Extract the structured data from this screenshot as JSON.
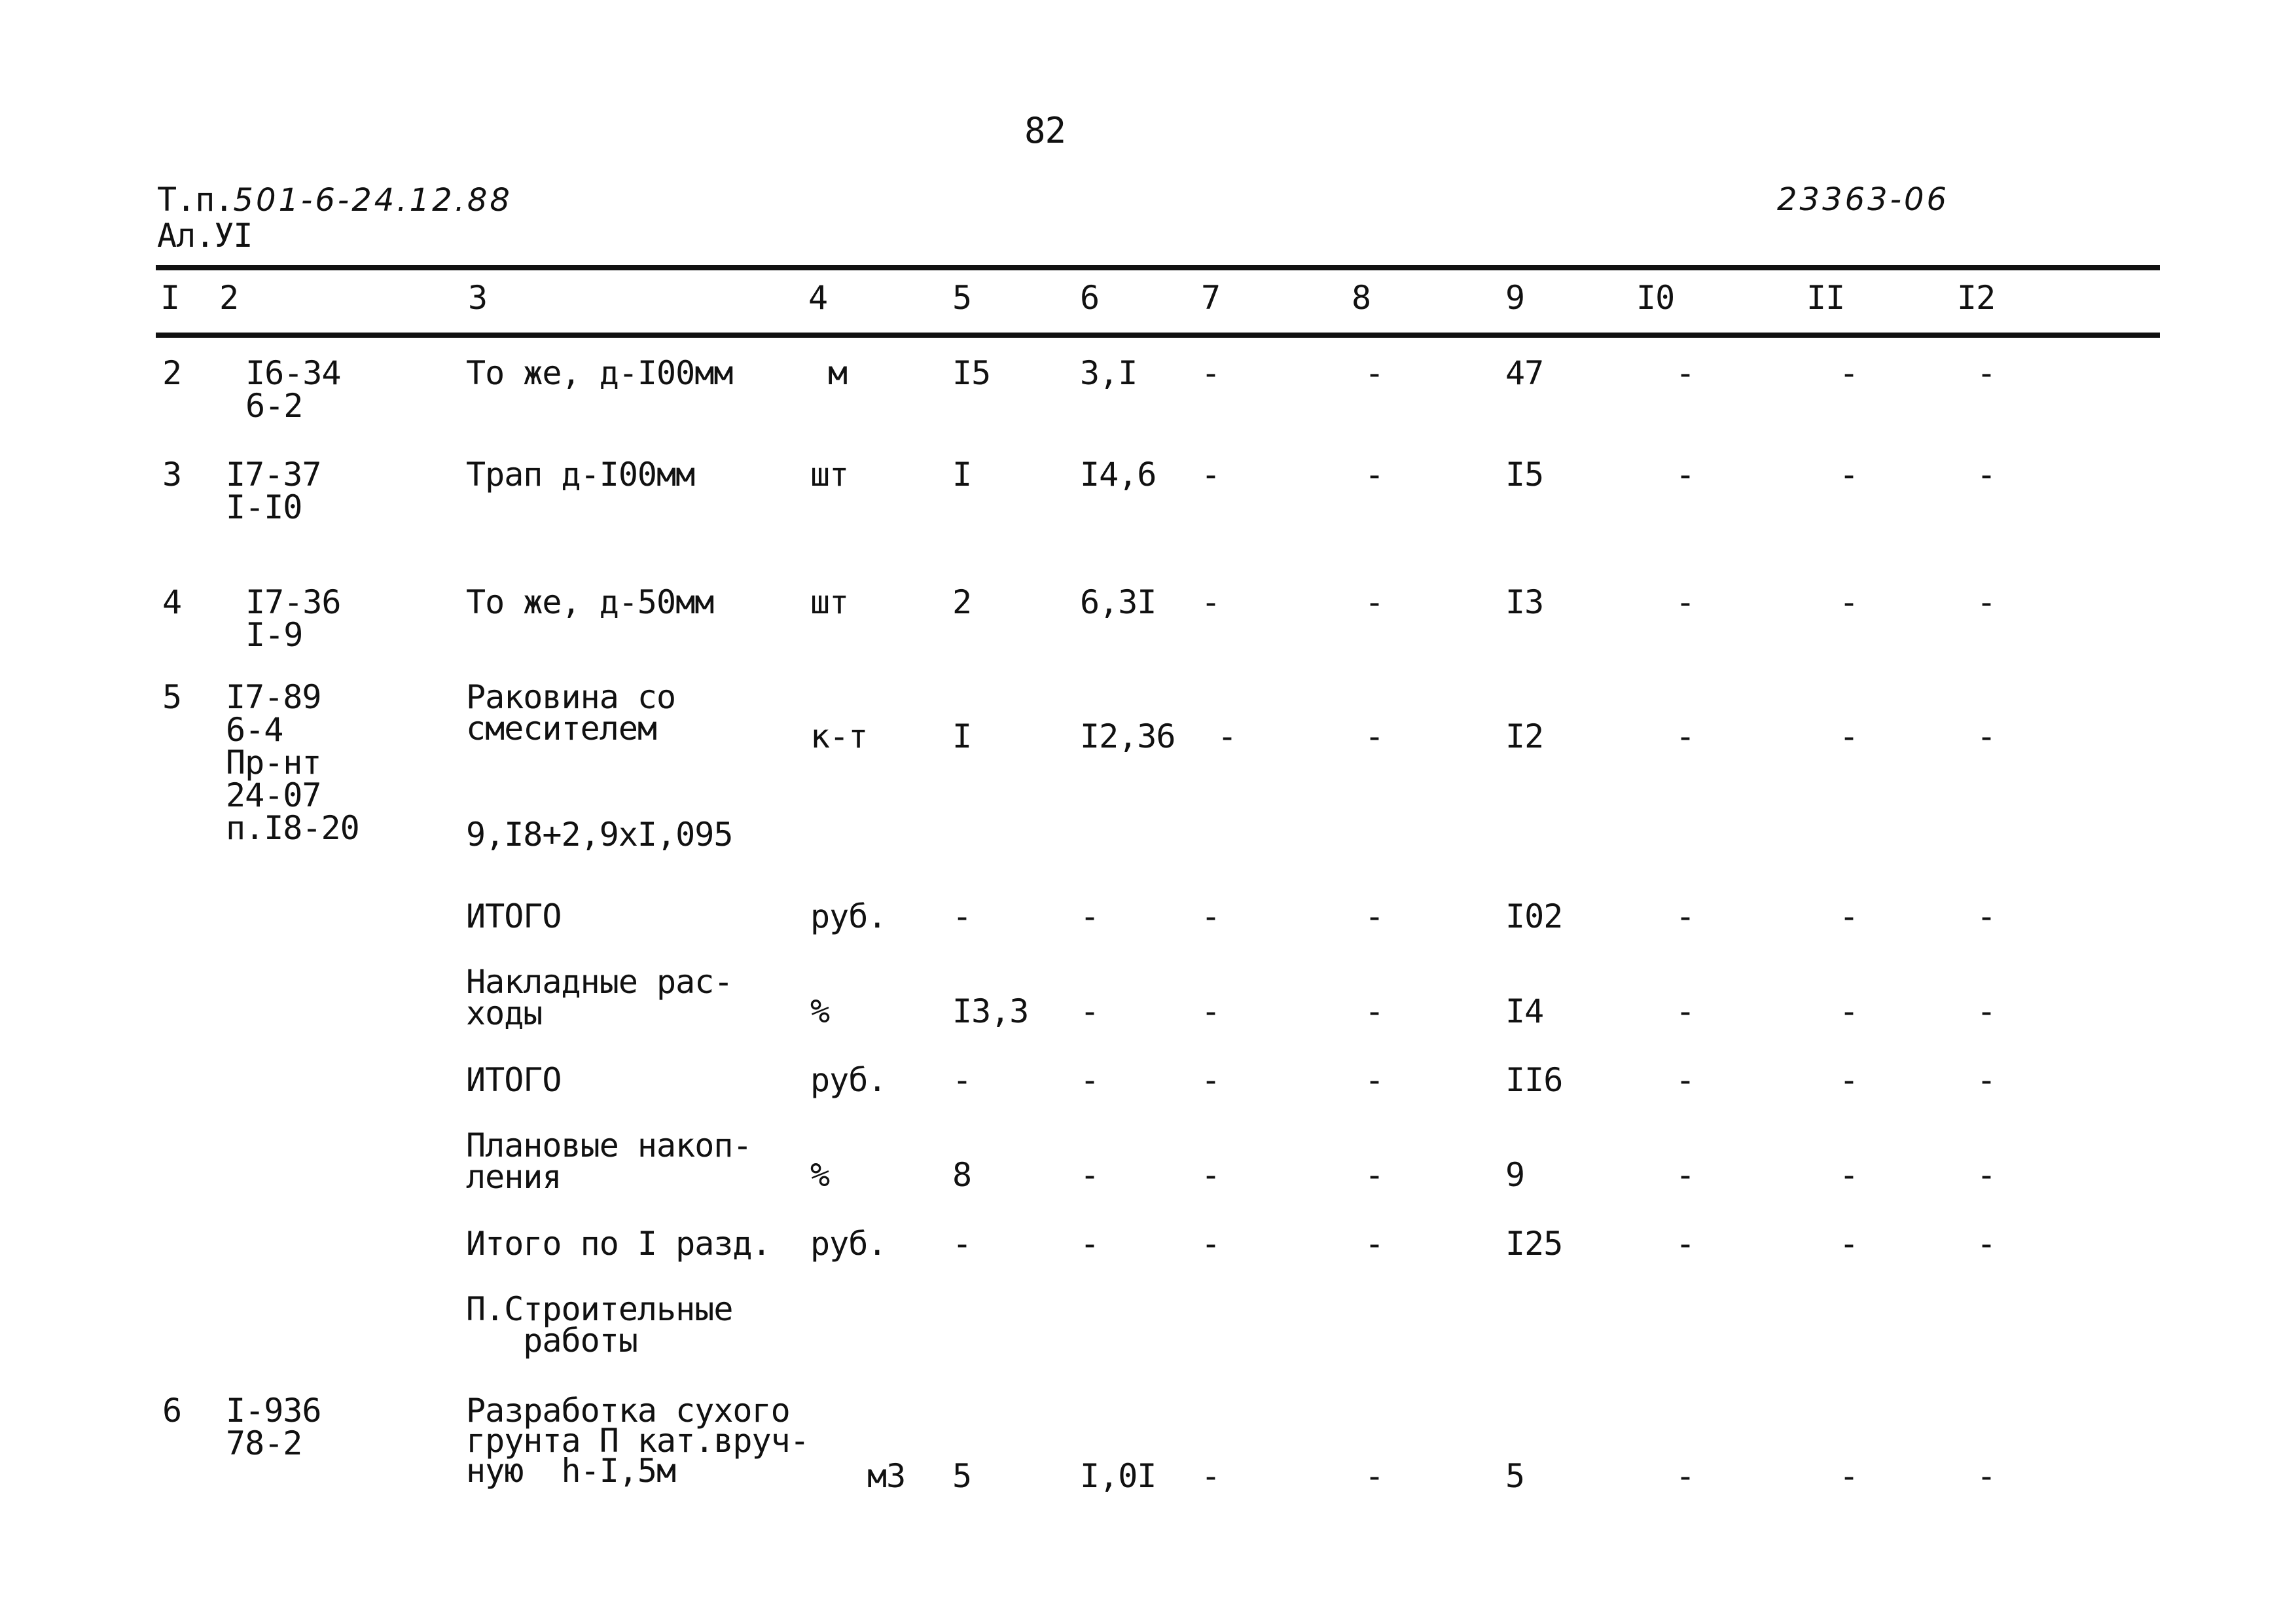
{
  "page_number": "82",
  "header": {
    "project_prefix": "Т.п.",
    "project_code": "501-6-24.12.88",
    "album": "Ал.УI",
    "doc_number": "23363-06"
  },
  "columns": [
    "I",
    "2",
    "3",
    "4",
    "5",
    "6",
    "7",
    "8",
    "9",
    "I0",
    "II",
    "I2"
  ],
  "rows": [
    {
      "c1": "2",
      "c2": [
        "I6-34",
        "6-2"
      ],
      "c3": [
        "То же, д-I00мм"
      ],
      "c4": "м",
      "c5": "I5",
      "c6": "3,I",
      "c7": "-",
      "c8": "-",
      "c9": "47",
      "c10": "-",
      "c11": "-",
      "c12": "-"
    },
    {
      "c1": "3",
      "c2": [
        "I7-37",
        "I-I0"
      ],
      "c3": [
        "Трап д-I00мм"
      ],
      "c4": "шт",
      "c5": "I",
      "c6": "I4,6",
      "c7": "-",
      "c8": "-",
      "c9": "I5",
      "c10": "-",
      "c11": "-",
      "c12": "-"
    },
    {
      "c1": "4",
      "c2": [
        "I7-36",
        "I-9"
      ],
      "c3": [
        "То же, д-50мм"
      ],
      "c4": "шт",
      "c5": "2",
      "c6": "6,3I",
      "c7": "-",
      "c8": "-",
      "c9": "I3",
      "c10": "-",
      "c11": "-",
      "c12": "-"
    },
    {
      "c1": "5",
      "c2": [
        "I7-89",
        "6-4",
        "Пр-нт",
        "24-07",
        "п.I8-20"
      ],
      "c3": [
        "Раковина со",
        "смесителем"
      ],
      "c3_formula": "9,I8+2,9хI,095",
      "c4": "к-т",
      "c5": "I",
      "c6": "I2,36",
      "c7": "-",
      "c8": "-",
      "c9": "I2",
      "c10": "-",
      "c11": "-",
      "c12": "-"
    },
    {
      "c1": "",
      "c2": [],
      "c3": [
        "ИТОГО"
      ],
      "c4": "руб.",
      "c5": "-",
      "c6": "-",
      "c7": "-",
      "c8": "-",
      "c9": "I02",
      "c10": "-",
      "c11": "-",
      "c12": "-"
    },
    {
      "c1": "",
      "c2": [],
      "c3": [
        "Накладные рас-",
        "ходы"
      ],
      "c4": "%",
      "c5": "I3,3",
      "c6": "-",
      "c7": "-",
      "c8": "-",
      "c9": "I4",
      "c10": "-",
      "c11": "-",
      "c12": "-"
    },
    {
      "c1": "",
      "c2": [],
      "c3": [
        "ИТОГО"
      ],
      "c4": "руб.",
      "c5": "-",
      "c6": "-",
      "c7": "-",
      "c8": "-",
      "c9": "II6",
      "c10": "-",
      "c11": "-",
      "c12": "-"
    },
    {
      "c1": "",
      "c2": [],
      "c3": [
        "Плановые накоп-",
        "ления"
      ],
      "c4": "%",
      "c5": "8",
      "c6": "-",
      "c7": "-",
      "c8": "-",
      "c9": "9",
      "c10": "-",
      "c11": "-",
      "c12": "-"
    },
    {
      "c1": "",
      "c2": [],
      "c3": [
        "Итого по I разд."
      ],
      "c4": "руб.",
      "c5": "-",
      "c6": "-",
      "c7": "-",
      "c8": "-",
      "c9": "I25",
      "c10": "-",
      "c11": "-",
      "c12": "-"
    },
    {
      "c1": "",
      "c2": [],
      "c3": [
        "П.Строительные",
        "   работы"
      ],
      "c4": "",
      "c5": "",
      "c6": "",
      "c7": "",
      "c8": "",
      "c9": "",
      "c10": "",
      "c11": "",
      "c12": ""
    },
    {
      "c1": "6",
      "c2": [
        "I-936",
        "78-2"
      ],
      "c3": [
        "Разработка сухого",
        "грунта П кат.вруч-",
        "ную  h-I,5м"
      ],
      "c4": "м3",
      "c5": "5",
      "c6": "I,0I",
      "c7": "-",
      "c8": "-",
      "c9": "5",
      "c10": "-",
      "c11": "-",
      "c12": "-"
    }
  ]
}
